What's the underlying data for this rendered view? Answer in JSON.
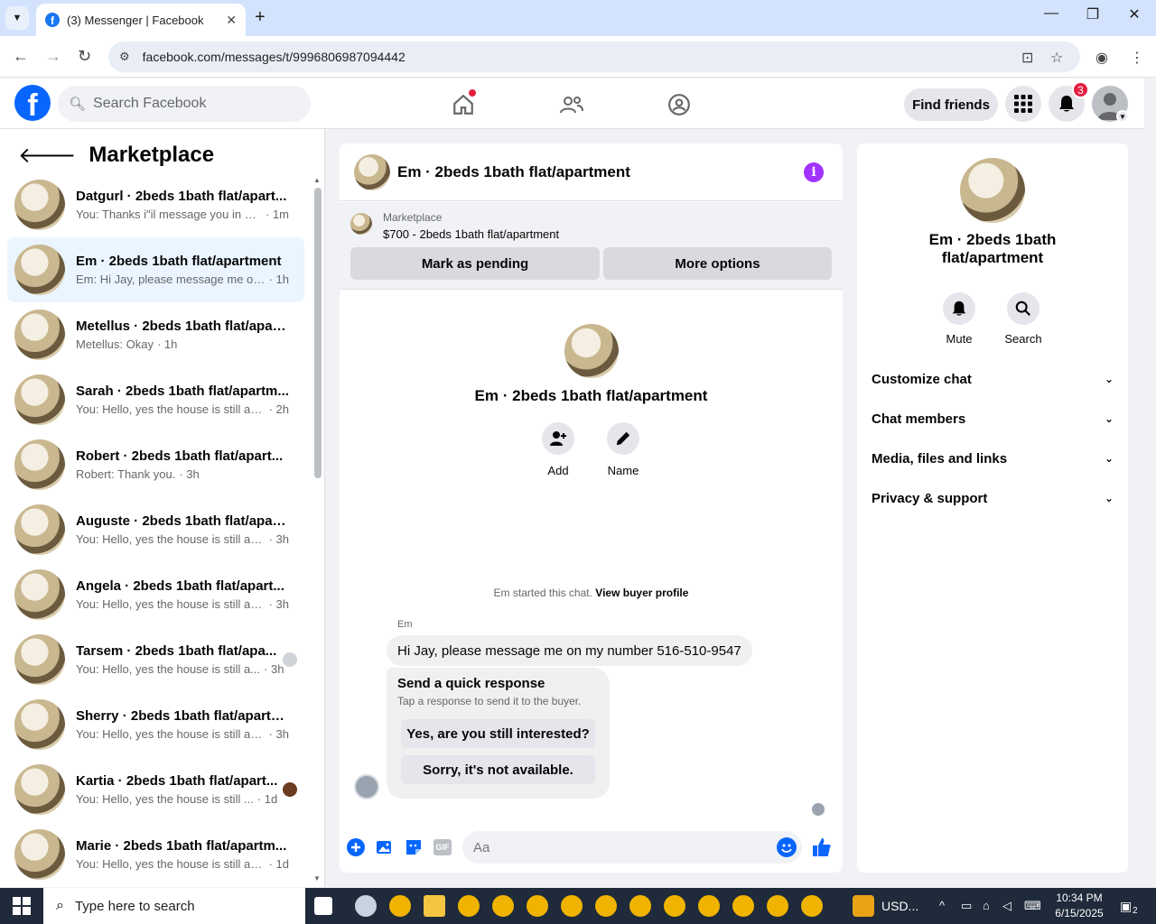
{
  "browser": {
    "tab_title": "(3) Messenger | Facebook",
    "url": "facebook.com/messages/t/9996806987094442"
  },
  "fb": {
    "search_placeholder": "Search Facebook",
    "find_friends": "Find friends",
    "notification_count": "3",
    "brand_color": "#0866ff"
  },
  "sidebar": {
    "title": "Marketplace",
    "conversations": [
      {
        "name": "Datgurl · 2beds 1bath flat/apart...",
        "preview": "You: Thanks i\"il message you in a ...",
        "time": "· 1m"
      },
      {
        "name": "Em · 2beds 1bath flat/apartment",
        "preview": "Em: Hi Jay, please message me on ...",
        "time": "· 1h"
      },
      {
        "name": "Metellus · 2beds 1bath flat/apart...",
        "preview": "Metellus: Okay",
        "time": "· 1h"
      },
      {
        "name": "Sarah · 2beds 1bath flat/apartm...",
        "preview": "You: Hello, yes the house is still avai...",
        "time": "· 2h"
      },
      {
        "name": "Robert · 2beds 1bath flat/apart...",
        "preview": "Robert: Thank you.",
        "time": "· 3h"
      },
      {
        "name": "Auguste · 2beds 1bath flat/apart...",
        "preview": "You: Hello, yes the house is still avai...",
        "time": "· 3h"
      },
      {
        "name": "Angela · 2beds 1bath flat/apart...",
        "preview": "You: Hello, yes the house is still avai...",
        "time": "· 3h"
      },
      {
        "name": "Tarsem · 2beds 1bath flat/apa...",
        "preview": "You: Hello, yes the house is still a...",
        "time": "· 3h"
      },
      {
        "name": "Sherry · 2beds 1bath flat/apartm...",
        "preview": "You: Hello, yes the house is still avai...",
        "time": "· 3h"
      },
      {
        "name": "Kartia · 2beds 1bath flat/apart...",
        "preview": "You: Hello, yes the house is still ...",
        "time": "· 1d"
      },
      {
        "name": "Marie · 2beds 1bath flat/apartm...",
        "preview": "You: Hello, yes the house is still ava...",
        "time": "· 1d"
      }
    ]
  },
  "chat": {
    "title": "Em · 2beds 1bath flat/apartment",
    "marketplace_label": "Marketplace",
    "listing": "$700 - 2beds 1bath flat/apartment",
    "mark_pending": "Mark as pending",
    "more_options": "More options",
    "center_name": "Em · 2beds 1bath flat/apartment",
    "add_label": "Add",
    "name_label": "Name",
    "started_text": "Em started this chat.",
    "view_buyer": "View buyer profile",
    "sender": "Em",
    "message": "Hi Jay, please message me on my number 516-510-9547",
    "quick_title": "Send a quick response",
    "quick_sub": "Tap a response to send it to the buyer.",
    "quick_1": "Yes, are you still interested?",
    "quick_2": "Sorry, it's not available.",
    "input_placeholder": "Aa"
  },
  "details": {
    "name": "Em · 2beds 1bath flat/apartment",
    "mute": "Mute",
    "search": "Search",
    "rows": [
      "Customize chat",
      "Chat members",
      "Media, files and links",
      "Privacy & support"
    ]
  },
  "taskbar": {
    "search_placeholder": "Type here to search",
    "currency": "USD...",
    "time": "10:34 PM",
    "date": "6/15/2025",
    "notif_count": "2"
  }
}
